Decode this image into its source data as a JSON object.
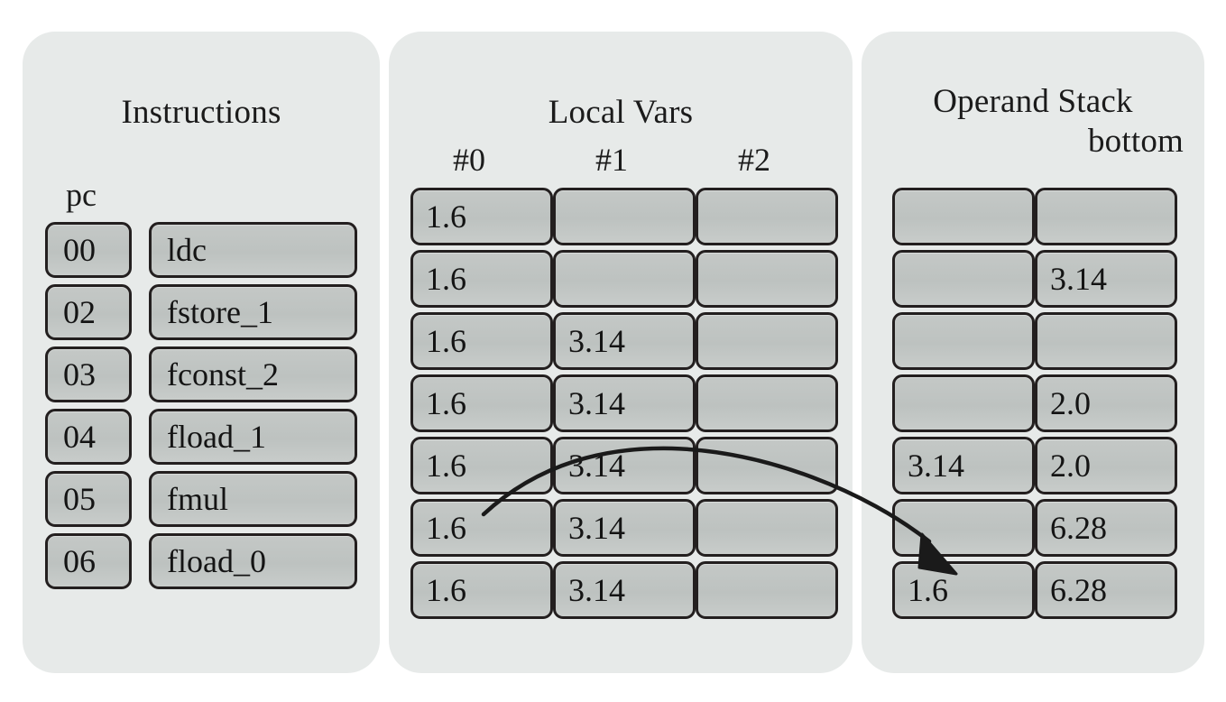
{
  "diagram": {
    "title_semantic": "jvm-frame-execution-trace"
  },
  "panels": {
    "instructions": {
      "title": "Instructions",
      "pc_label": "pc",
      "rows": [
        {
          "pc": "00",
          "mnemonic": "ldc"
        },
        {
          "pc": "02",
          "mnemonic": "fstore_1"
        },
        {
          "pc": "03",
          "mnemonic": "fconst_2"
        },
        {
          "pc": "04",
          "mnemonic": "fload_1"
        },
        {
          "pc": "05",
          "mnemonic": "fmul"
        },
        {
          "pc": "06",
          "mnemonic": "fload_0"
        }
      ]
    },
    "local_vars": {
      "title": "Local Vars",
      "columns": [
        "#0",
        "#1",
        "#2"
      ],
      "rows": [
        [
          "1.6",
          "",
          ""
        ],
        [
          "1.6",
          "",
          ""
        ],
        [
          "1.6",
          "3.14",
          ""
        ],
        [
          "1.6",
          "3.14",
          ""
        ],
        [
          "1.6",
          "3.14",
          ""
        ],
        [
          "1.6",
          "3.14",
          ""
        ],
        [
          "1.6",
          "3.14",
          ""
        ]
      ]
    },
    "operand_stack": {
      "title_line1": "Operand Stack",
      "title_line2": "bottom",
      "rows": [
        [
          "",
          ""
        ],
        [
          "",
          "3.14"
        ],
        [
          "",
          ""
        ],
        [
          "",
          "2.0"
        ],
        [
          "3.14",
          "2.0"
        ],
        [
          "",
          "6.28"
        ],
        [
          "1.6",
          "6.28"
        ]
      ]
    }
  },
  "annotations": {
    "arrow": {
      "name": "fload-0-copy-arrow",
      "from": "local-vars row 5 slot #0 (1.6)",
      "to": "operand stack row 6 left cell"
    }
  },
  "colors": {
    "panel_background": "#e7eae9",
    "cell_fill": "#c2c6c4",
    "cell_border": "#231f1f",
    "text": "#141414",
    "page_background": "#ffffff"
  }
}
